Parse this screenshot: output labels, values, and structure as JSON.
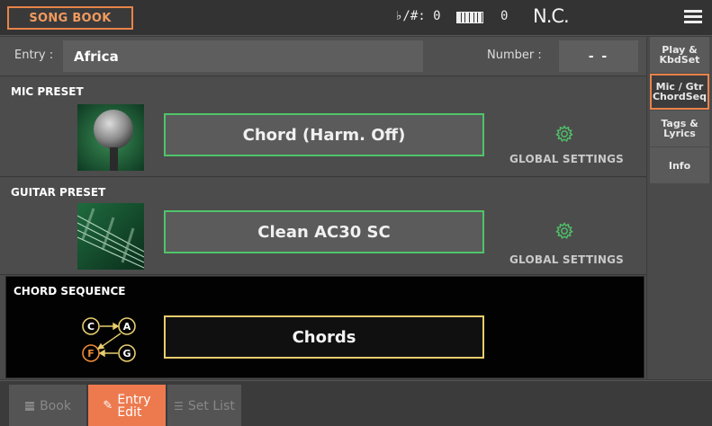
{
  "header": {
    "title": "SONG BOOK",
    "transpose": "♭/#: 0",
    "keyboard_value": "0",
    "chord": "N.C."
  },
  "entry": {
    "label": "Entry :",
    "value": "Africa",
    "number_label": "Number :",
    "number_value": "- -"
  },
  "mic_preset": {
    "title": "MIC PRESET",
    "value": "Chord (Harm. Off)",
    "global": "GLOBAL SETTINGS"
  },
  "guitar_preset": {
    "title": "GUITAR PRESET",
    "value": "Clean AC30 SC",
    "global": "GLOBAL SETTINGS"
  },
  "chord_sequence": {
    "title": "CHORD SEQUENCE",
    "value": "Chords",
    "icon_letters": [
      "C",
      "A",
      "F",
      "G"
    ]
  },
  "side_tabs": [
    {
      "line1": "Play &",
      "line2": "KbdSet"
    },
    {
      "line1": "Mic / Gtr",
      "line2": "ChordSeq"
    },
    {
      "line1": "Tags &",
      "line2": "Lyrics"
    },
    {
      "line1": "Info",
      "line2": ""
    }
  ],
  "bottom_tabs": {
    "book": "Book",
    "entry_line1": "Entry",
    "entry_line2": "Edit",
    "setlist": "Set List"
  },
  "colors": {
    "accent": "#e9834a",
    "green_border": "#4fc46a",
    "yellow_border": "#e7cd6e"
  }
}
